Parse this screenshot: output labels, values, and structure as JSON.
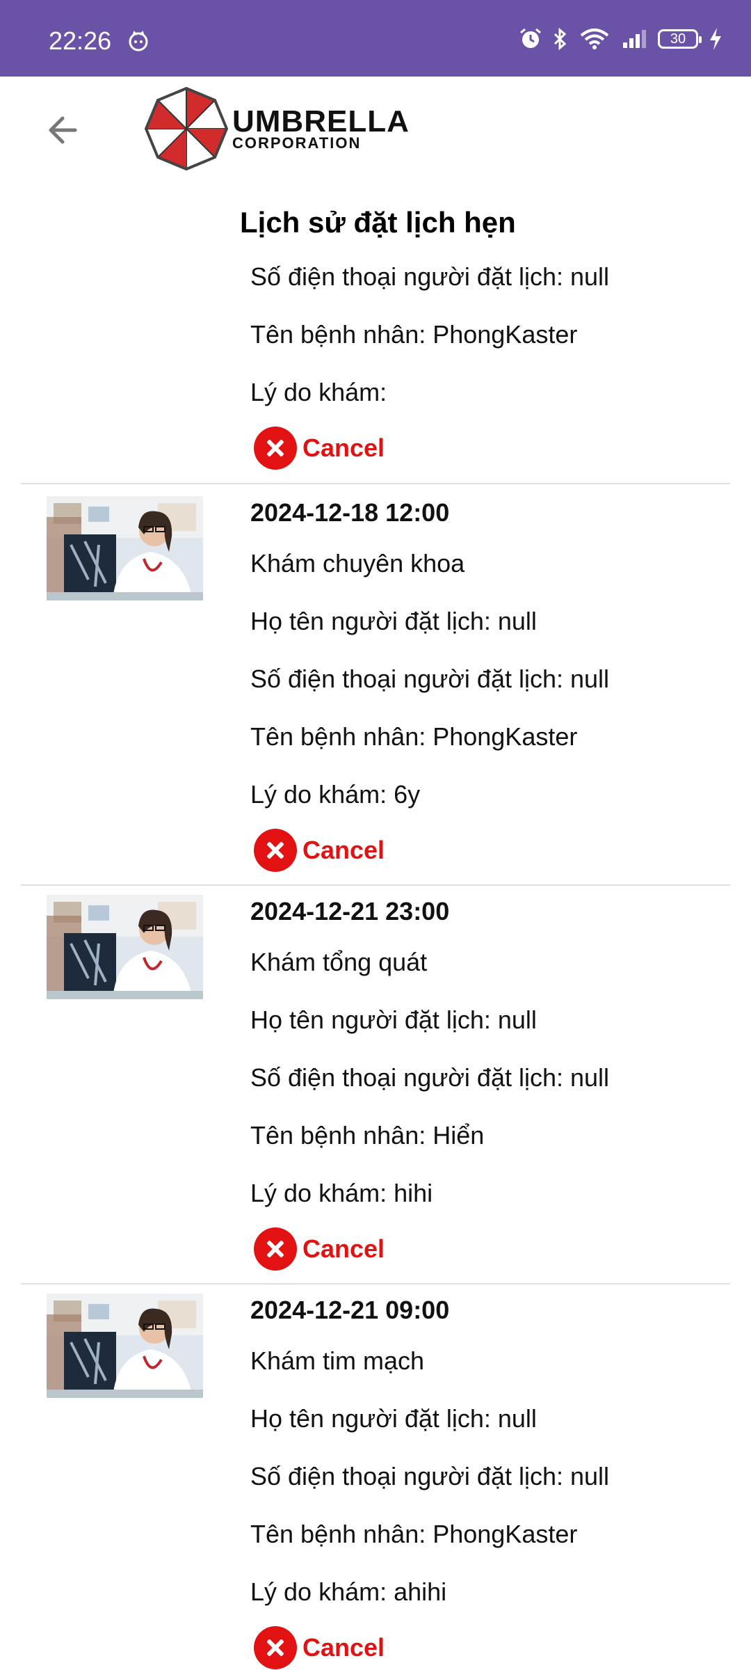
{
  "status_bar": {
    "time": "22:26",
    "battery": "30",
    "icons": [
      "cat-icon",
      "alarm-icon",
      "bluetooth-icon",
      "wifi-icon",
      "signal-icon",
      "battery-icon",
      "charging-icon"
    ],
    "bg_color": "#6a52a6"
  },
  "header": {
    "logo_main": "UMBRELLA",
    "logo_sub": "CORPORATION",
    "title": "Lịch sử đặt lịch hẹn"
  },
  "partial_item": {
    "phone": "Số điện thoại người đặt lịch: null",
    "patient": "Tên bệnh nhân: PhongKaster",
    "reason": "Lý do khám:",
    "cancel": "Cancel"
  },
  "appointments": [
    {
      "datetime": "2024-12-18 12:00",
      "service": "Khám chuyên khoa",
      "booker": "Họ tên người đặt lịch: null",
      "phone": "Số điện thoại người đặt lịch: null",
      "patient": "Tên bệnh nhân: PhongKaster",
      "reason": "Lý do khám: 6y",
      "cancel": "Cancel"
    },
    {
      "datetime": "2024-12-21 23:00",
      "service": "Khám tổng quát",
      "booker": "Họ tên người đặt lịch: null",
      "phone": "Số điện thoại người đặt lịch: null",
      "patient": "Tên bệnh nhân: Hiển",
      "reason": "Lý do khám: hihi",
      "cancel": "Cancel"
    },
    {
      "datetime": "2024-12-21 09:00",
      "service": "Khám tim mạch",
      "booker": "Họ tên người đặt lịch: null",
      "phone": "Số điện thoại người đặt lịch: null",
      "patient": "Tên bệnh nhân: PhongKaster",
      "reason": "Lý do khám: ahihi",
      "cancel": "Cancel"
    }
  ],
  "colors": {
    "accent": "#e21212",
    "divider": "#e0e0e0"
  }
}
